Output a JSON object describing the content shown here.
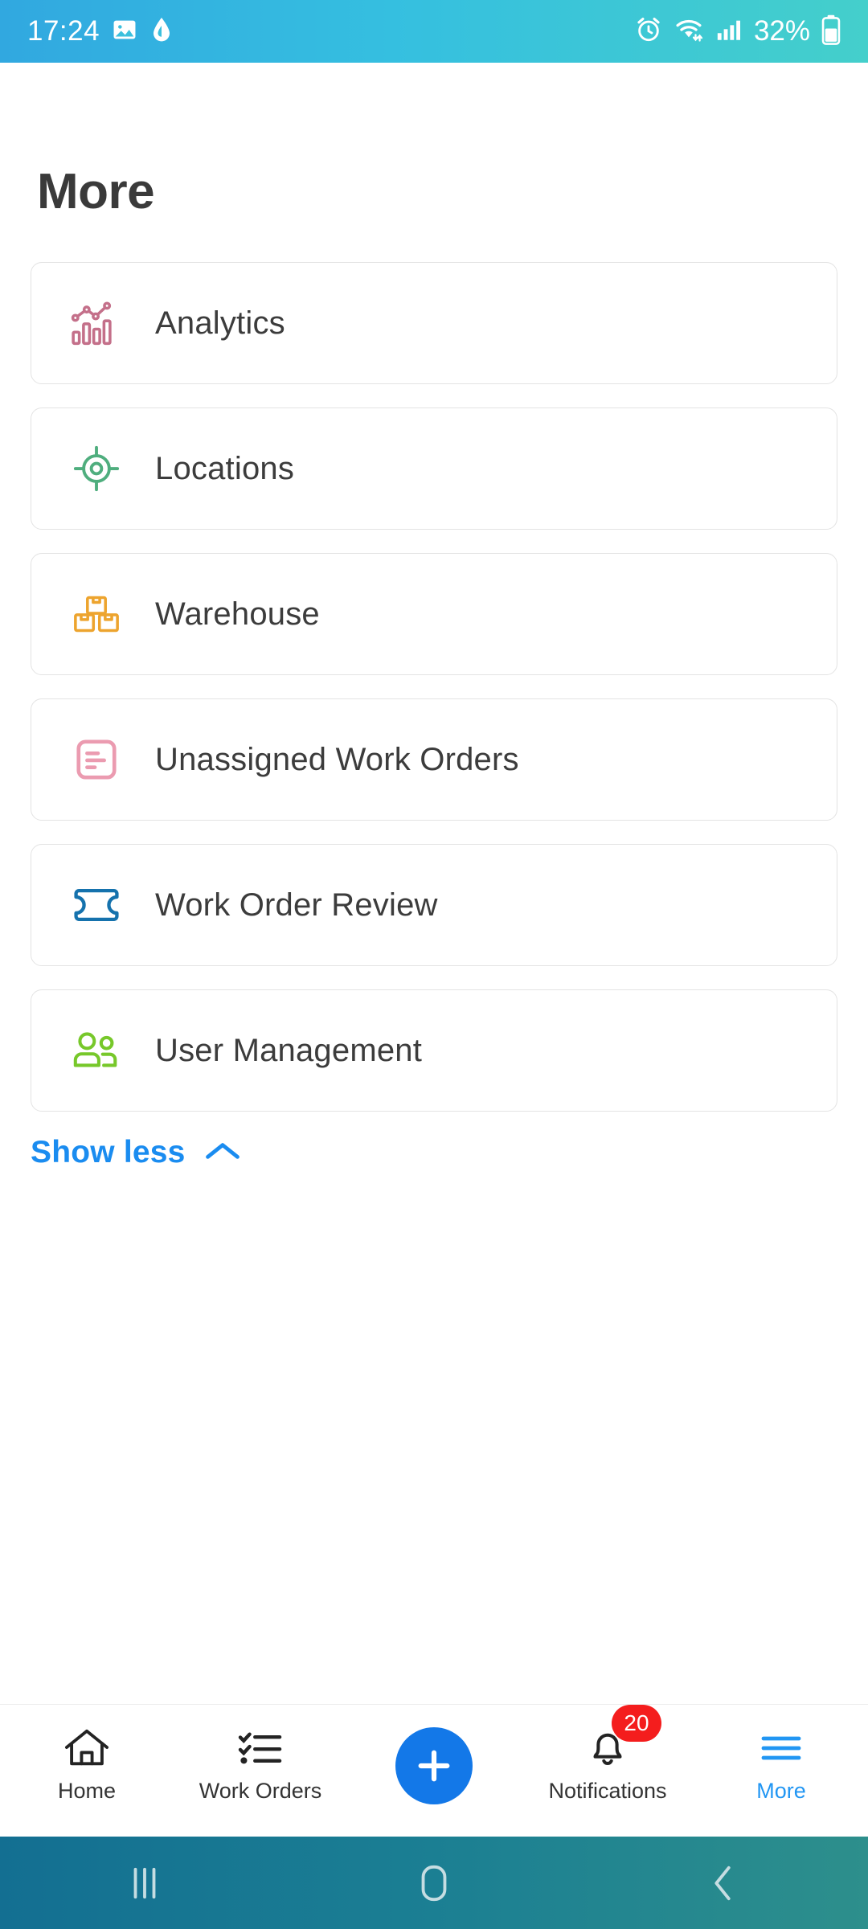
{
  "status_bar": {
    "time": "17:24",
    "battery_text": "32%",
    "left_icons": [
      "image-icon",
      "water-drop-icon"
    ],
    "right_icons": [
      "alarm-icon",
      "wifi-icon",
      "signal-icon",
      "battery-icon"
    ]
  },
  "header": {
    "title": "More"
  },
  "menu": {
    "items": [
      {
        "label": "Analytics",
        "icon": "analytics-chart-icon",
        "color": "#c4708a"
      },
      {
        "label": "Locations",
        "icon": "location-target-icon",
        "color": "#4fae7e"
      },
      {
        "label": "Warehouse",
        "icon": "boxes-stack-icon",
        "color": "#eda42e"
      },
      {
        "label": "Unassigned Work Orders",
        "icon": "document-lines-icon",
        "color": "#eb9bb0"
      },
      {
        "label": "Work Order Review",
        "icon": "ticket-icon",
        "color": "#1572ad"
      },
      {
        "label": "User Management",
        "icon": "users-group-icon",
        "color": "#77c82a"
      }
    ]
  },
  "show_less": {
    "label": "Show less",
    "icon": "chevron-up-icon",
    "color": "#1a8cf0"
  },
  "bottom_nav": {
    "active_color": "#2196f3",
    "tabs": [
      {
        "label": "Home",
        "icon": "home-icon",
        "active": false
      },
      {
        "label": "Work Orders",
        "icon": "checklist-icon",
        "active": false
      },
      {
        "label": "",
        "icon": "plus-icon",
        "active": false
      },
      {
        "label": "Notifications",
        "icon": "bell-icon",
        "active": false,
        "badge": "20"
      },
      {
        "label": "More",
        "icon": "hamburger-icon",
        "active": true
      }
    ]
  },
  "system_nav": {
    "buttons": [
      {
        "icon": "recents-icon"
      },
      {
        "icon": "home-square-icon"
      },
      {
        "icon": "back-chevron-icon"
      }
    ]
  }
}
